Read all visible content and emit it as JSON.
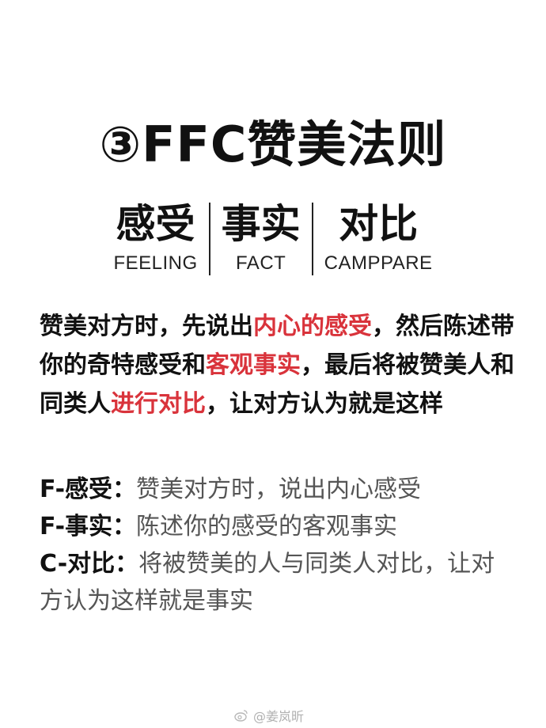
{
  "title": "③FFC赞美法则",
  "pillars": [
    {
      "cn": "感受",
      "en": "FEELING"
    },
    {
      "cn": "事实",
      "en": "FACT"
    },
    {
      "cn": "对比",
      "en": "CAMPPARE"
    }
  ],
  "paragraph": {
    "p1": "赞美对方时，先说出",
    "h1": "内心的感受",
    "p2": "，然后陈述带你的奇特感受和",
    "h2": "客观事实",
    "p3": "，最后将被赞美人和同类人",
    "h3": "进行对比",
    "p4": "，让对方认为就是这样"
  },
  "definitions": [
    {
      "key": "F-感受：",
      "value": "赞美对方时，说出内心感受"
    },
    {
      "key": "F-事实：",
      "value": "陈述你的感受的客观事实"
    },
    {
      "key": "C-对比：",
      "value": "将被赞美的人与同类人对比，让对方认为这样就是事实"
    }
  ],
  "watermark": "@姜岚昕",
  "colors": {
    "highlight": "#d9333b",
    "text": "#111111",
    "muted": "#555555"
  }
}
